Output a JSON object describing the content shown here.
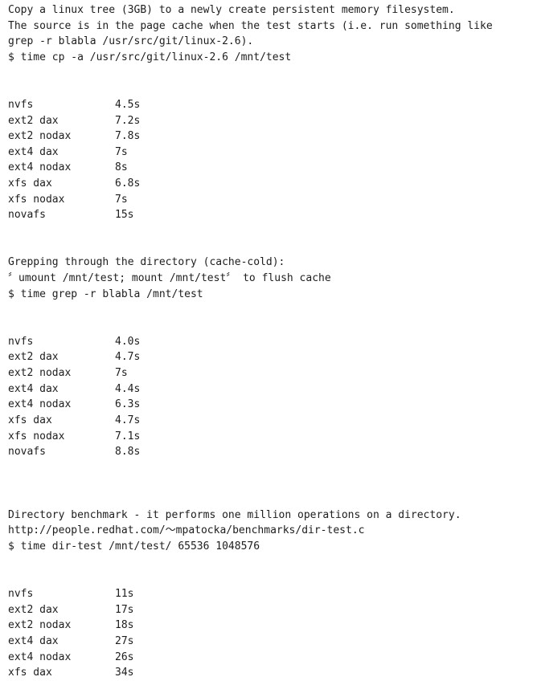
{
  "document": {
    "background_color": "#ffffff",
    "text_color": "#1d1d1d"
  },
  "sections": [
    {
      "id": "copy-benchmark",
      "description_lines": [
        "Copy a linux tree (3GB) to a newly create persistent memory filesystem.",
        "The source is in the page cache when the test starts (i.e. run something like",
        "grep -r blabla /usr/src/git/linux-2.6)."
      ],
      "command": "$ time cp -a /usr/src/git/linux-2.6 /mnt/test",
      "rows": [
        {
          "filesystem": "nvfs",
          "time": "4.5s"
        },
        {
          "filesystem": "ext2 dax",
          "time": "7.2s"
        },
        {
          "filesystem": "ext2 nodax",
          "time": "7.8s"
        },
        {
          "filesystem": "ext4 dax",
          "time": "7s"
        },
        {
          "filesystem": "ext4 nodax",
          "time": "8s"
        },
        {
          "filesystem": "xfs dax",
          "time": "6.8s"
        },
        {
          "filesystem": "xfs nodax",
          "time": "7s"
        },
        {
          "filesystem": "novafs",
          "time": "15s"
        }
      ]
    },
    {
      "id": "grep-benchmark",
      "description_lines": [
        "Grepping through the directory (cache-cold):",
        "〞umount /mnt/test; mount /mnt/test〞 to flush cache"
      ],
      "command": "$ time grep -r blabla /mnt/test",
      "rows": [
        {
          "filesystem": "nvfs",
          "time": "4.0s"
        },
        {
          "filesystem": "ext2 dax",
          "time": "4.7s"
        },
        {
          "filesystem": "ext2 nodax",
          "time": "7s"
        },
        {
          "filesystem": "ext4 dax",
          "time": "4.4s"
        },
        {
          "filesystem": "ext4 nodax",
          "time": "6.3s"
        },
        {
          "filesystem": "xfs dax",
          "time": "4.7s"
        },
        {
          "filesystem": "xfs nodax",
          "time": "7.1s"
        },
        {
          "filesystem": "novafs",
          "time": "8.8s"
        }
      ]
    },
    {
      "id": "directory-benchmark",
      "description_lines": [
        "Directory benchmark - it performs one million operations on a directory.",
        "http://people.redhat.com/〜mpatocka/benchmarks/dir-test.c"
      ],
      "command": "$ time dir-test /mnt/test/ 65536 1048576",
      "rows": [
        {
          "filesystem": "nvfs",
          "time": "11s"
        },
        {
          "filesystem": "ext2 dax",
          "time": "17s"
        },
        {
          "filesystem": "ext2 nodax",
          "time": "18s"
        },
        {
          "filesystem": "ext4 dax",
          "time": "27s"
        },
        {
          "filesystem": "ext4 nodax",
          "time": "26s"
        },
        {
          "filesystem": "xfs dax",
          "time": "34s"
        }
      ]
    }
  ]
}
